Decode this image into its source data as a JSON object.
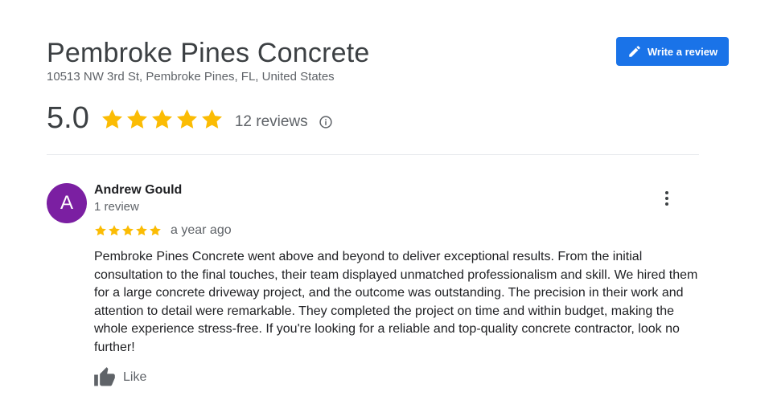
{
  "business": {
    "name": "Pembroke Pines Concrete",
    "address": "10513 NW 3rd St, Pembroke Pines, FL, United States"
  },
  "actions": {
    "write_review_label": "Write a review",
    "write_review_icon": "pencil-icon"
  },
  "rating": {
    "value": "5.0",
    "stars": 5,
    "max_stars": 5,
    "count_label": "12 reviews",
    "info_icon": "info-icon"
  },
  "review": {
    "avatar_letter": "A",
    "reviewer_name": "Andrew Gould",
    "reviewer_reviews": "1 review",
    "stars": 5,
    "date": "a year ago",
    "text": "Pembroke Pines Concrete went above and beyond to deliver exceptional results. From the initial consultation to the final touches, their team displayed unmatched professionalism and skill. We hired them for a large concrete driveway project, and the outcome was outstanding. The precision in their work and attention to detail were remarkable. They completed the project on time and within budget, making the whole experience stress-free. If you're looking for a reliable and top-quality concrete contractor, look no further!",
    "like_label": "Like",
    "like_icon": "thumbs-up-icon",
    "more_icon": "more-vert-icon"
  },
  "colors": {
    "accent": "#1a73e8",
    "star": "#fbbc04",
    "avatar": "#7b1fa2",
    "divider": "#e8eaed",
    "secondary_text": "#5f6368"
  }
}
